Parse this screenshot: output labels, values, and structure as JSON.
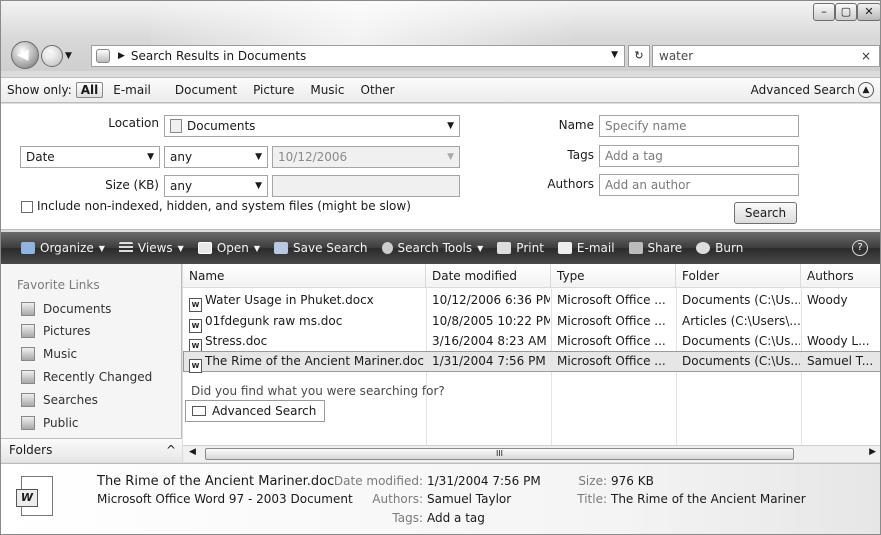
{
  "window": {
    "caption_buttons": [
      "–",
      "▢",
      "✕"
    ]
  },
  "address": {
    "breadcrumb": "Search Results in Documents",
    "search_value": "water",
    "search_clear": "×"
  },
  "show_only": {
    "label": "Show only:",
    "options": [
      "All",
      "E-mail",
      "Document",
      "Picture",
      "Music",
      "Other"
    ],
    "selected": "All",
    "advanced_search": "Advanced Search"
  },
  "criteria": {
    "location_label": "Location",
    "location_value": "Documents",
    "date_field": "Date",
    "date_op": "any",
    "date_value": "10/12/2006",
    "size_label": "Size (KB)",
    "size_op": "any",
    "name_label": "Name",
    "name_placeholder": "Specify name",
    "tags_label": "Tags",
    "tags_placeholder": "Add a tag",
    "authors_label": "Authors",
    "authors_placeholder": "Add an author",
    "include_label": "Include non-indexed, hidden, and system files (might be slow)",
    "search_button": "Search"
  },
  "toolbar": {
    "items": [
      {
        "label": "Organize",
        "caret": true,
        "icon": "organize-icon"
      },
      {
        "label": "Views",
        "caret": true,
        "icon": "views-icon"
      },
      {
        "label": "Open",
        "caret": true,
        "icon": "word-open-icon"
      },
      {
        "label": "Save Search",
        "caret": false,
        "icon": "save-icon"
      },
      {
        "label": "Search Tools",
        "caret": true,
        "icon": "search-tools-icon"
      },
      {
        "label": "Print",
        "caret": false,
        "icon": "printer-icon"
      },
      {
        "label": "E-mail",
        "caret": false,
        "icon": "email-icon"
      },
      {
        "label": "Share",
        "caret": false,
        "icon": "share-icon"
      },
      {
        "label": "Burn",
        "caret": false,
        "icon": "burn-icon"
      }
    ],
    "help": "?"
  },
  "nav": {
    "header": "Favorite Links",
    "items": [
      "Documents",
      "Pictures",
      "Music",
      "Recently Changed",
      "Searches",
      "Public"
    ],
    "folders_label": "Folders",
    "folders_chevron": "^"
  },
  "list": {
    "columns": [
      "Name",
      "Date modified",
      "Type",
      "Folder",
      "Authors"
    ],
    "rows": [
      {
        "name": "Water Usage in Phuket.docx",
        "date": "10/12/2006 6:36 PM",
        "type": "Microsoft Office ...",
        "folder": "Documents (C:\\Us...",
        "authors": "Woody"
      },
      {
        "name": "01fdegunk raw ms.doc",
        "date": "10/8/2005 10:22 PM",
        "type": "Microsoft Office ...",
        "folder": "Articles (C:\\Users\\...",
        "authors": ""
      },
      {
        "name": "Stress.doc",
        "date": "3/16/2004 8:23 AM",
        "type": "Microsoft Office ...",
        "folder": "Documents (C:\\Us...",
        "authors": "Woody L..."
      },
      {
        "name": "The Rime of the Ancient Mariner.doc",
        "date": "1/31/2004 7:56 PM",
        "type": "Microsoft Office ...",
        "folder": "Documents (C:\\Us...",
        "authors": "Samuel T..."
      }
    ],
    "selected_index": 3,
    "found_prompt": "Did you find what you were searching for?",
    "advanced_search_button": "Advanced Search",
    "scroll_grip": "III"
  },
  "details": {
    "filename": "The Rime of the Ancient Mariner.doc",
    "filetype": "Microsoft Office Word 97 - 2003 Document",
    "date_modified_label": "Date modified:",
    "date_modified_value": "1/31/2004 7:56 PM",
    "authors_label": "Authors:",
    "authors_value": "Samuel Taylor",
    "tags_label": "Tags:",
    "tags_value": "Add a tag",
    "size_label": "Size:",
    "size_value": "976 KB",
    "title_label": "Title:",
    "title_value": "The Rime of the Ancient Mariner"
  }
}
